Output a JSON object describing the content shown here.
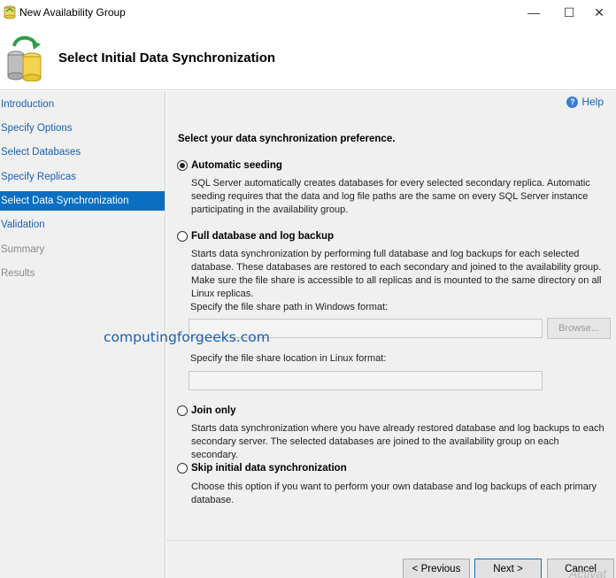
{
  "window": {
    "title": "New Availability Group",
    "minimize_label": "—",
    "maximize_label": "☐",
    "close_label": "✕"
  },
  "header": {
    "title": "Select Initial Data Synchronization"
  },
  "sidebar": {
    "items": [
      {
        "label": "Introduction",
        "state": "link"
      },
      {
        "label": "Specify Options",
        "state": "link"
      },
      {
        "label": "Select Databases",
        "state": "link"
      },
      {
        "label": "Specify Replicas",
        "state": "link"
      },
      {
        "label": "Select Data Synchronization",
        "state": "active"
      },
      {
        "label": "Validation",
        "state": "link"
      },
      {
        "label": "Summary",
        "state": "disabled"
      },
      {
        "label": "Results",
        "state": "disabled"
      }
    ]
  },
  "main": {
    "help_label": "Help",
    "prompt": "Select your data synchronization preference.",
    "options": [
      {
        "label": "Automatic seeding",
        "checked": true,
        "description": "SQL Server automatically creates databases for every selected secondary replica. Automatic seeding requires that the data and log file paths are the same on every SQL Server instance participating in the availability group."
      },
      {
        "label": "Full database and log backup",
        "checked": false,
        "description": "Starts data synchronization by performing full database and log backups for each selected database. These databases are restored to each secondary and joined to the availability group. Make sure the file share is accessible to all replicas and is mounted to the same directory on all Linux replicas."
      },
      {
        "label": "Join only",
        "checked": false,
        "description": "Starts data synchronization where you have already restored database and log backups to each secondary server. The selected databases are joined to the availability group on each secondary."
      },
      {
        "label": "Skip initial data synchronization",
        "checked": false,
        "description": "Choose this option if you want to perform your own database and log backups of each primary database."
      }
    ],
    "windows_path_label": "Specify the file share path in Windows format:",
    "windows_path_value": "",
    "browse_label": "Browse...",
    "linux_path_label": "Specify the file share location in Linux format:",
    "linux_path_value": ""
  },
  "watermark": "computingforgeeks.com",
  "footer": {
    "previous_label": "< Previous",
    "next_label": "Next >",
    "cancel_label": "Cancel"
  },
  "overlay_text": "Activat",
  "colors": {
    "accent": "#0a6fc2",
    "link": "#1a5fb4",
    "panel_bg": "#f0f0f0"
  }
}
